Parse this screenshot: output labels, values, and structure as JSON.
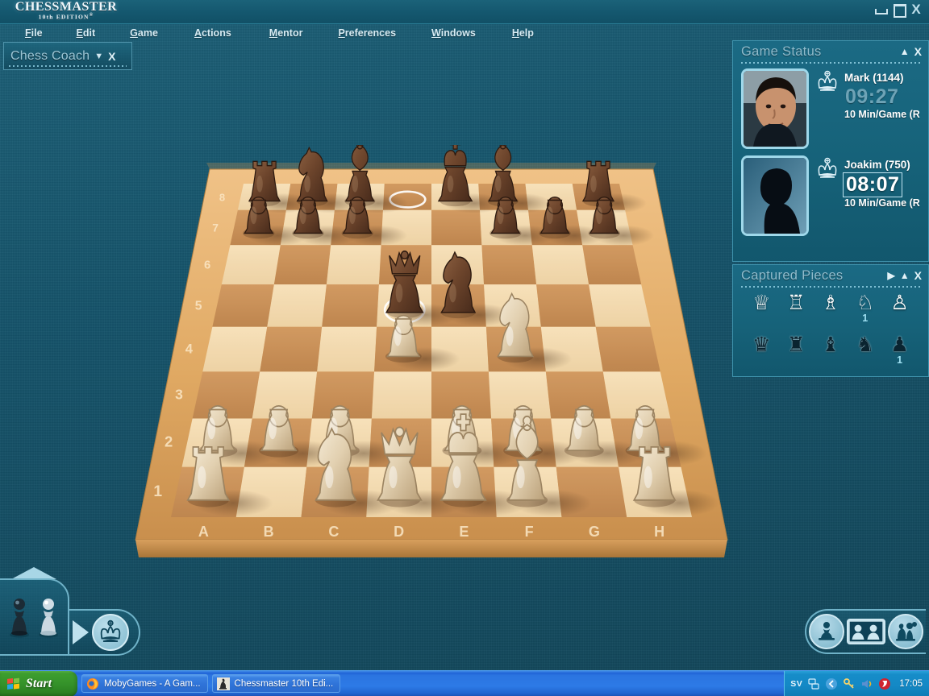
{
  "app": {
    "logo_line1": "CHESSMASTER",
    "logo_line2": "10th EDITION",
    "logo_registered": "®"
  },
  "window_controls": {
    "minimize": "minimize-icon",
    "maximize": "maximize-icon",
    "close": "X"
  },
  "menubar": {
    "items": [
      {
        "label": "File"
      },
      {
        "label": "Edit"
      },
      {
        "label": "Game"
      },
      {
        "label": "Actions"
      },
      {
        "label": "Mentor"
      },
      {
        "label": "Preferences"
      },
      {
        "label": "Windows"
      },
      {
        "label": "Help"
      }
    ]
  },
  "coach_panel": {
    "title": "Chess Coach",
    "collapse_caret": "▼",
    "close": "X"
  },
  "game_status": {
    "title": "Game Status",
    "collapse_caret": "▲",
    "close": "X",
    "players": [
      {
        "name": "Mark (1144)",
        "rating": "1144",
        "clock": "09:27",
        "time_control": "10 Min/Game (R",
        "side": "white",
        "active": false,
        "portrait": "photo-portrait"
      },
      {
        "name": "Joakim (750)",
        "rating": "750",
        "clock": "08:07",
        "time_control": "10 Min/Game (R",
        "side": "black",
        "active": true,
        "portrait": "silhouette-portrait"
      }
    ]
  },
  "captured_pieces": {
    "title": "Captured Pieces",
    "expand_caret": "▶",
    "collapse_caret": "▲",
    "close": "X",
    "rows": [
      {
        "color": "white",
        "cells": [
          {
            "piece": "queen",
            "glyph": "♕",
            "count": ""
          },
          {
            "piece": "rook",
            "glyph": "♖",
            "count": ""
          },
          {
            "piece": "bishop",
            "glyph": "♗",
            "count": ""
          },
          {
            "piece": "knight",
            "glyph": "♘",
            "count": "1"
          },
          {
            "piece": "pawn",
            "glyph": "♙",
            "count": ""
          }
        ]
      },
      {
        "color": "black",
        "cells": [
          {
            "piece": "queen",
            "glyph": "♛",
            "count": ""
          },
          {
            "piece": "rook",
            "glyph": "♜",
            "count": ""
          },
          {
            "piece": "bishop",
            "glyph": "♝",
            "count": ""
          },
          {
            "piece": "knight",
            "glyph": "♞",
            "count": ""
          },
          {
            "piece": "pawn",
            "glyph": "♟",
            "count": "1"
          }
        ]
      }
    ]
  },
  "board": {
    "files": [
      "A",
      "B",
      "C",
      "D",
      "E",
      "F",
      "G",
      "H"
    ],
    "ranks": [
      "8",
      "7",
      "6",
      "5",
      "4",
      "3",
      "2",
      "1"
    ],
    "highlights": [
      {
        "square": "D8",
        "type": "ring"
      },
      {
        "square": "D5",
        "type": "ring"
      }
    ],
    "pieces": [
      {
        "square": "A8",
        "color": "black",
        "type": "rook"
      },
      {
        "square": "B8",
        "color": "black",
        "type": "knight"
      },
      {
        "square": "C8",
        "color": "black",
        "type": "bishop"
      },
      {
        "square": "E8",
        "color": "black",
        "type": "king"
      },
      {
        "square": "F8",
        "color": "black",
        "type": "bishop"
      },
      {
        "square": "H8",
        "color": "black",
        "type": "rook"
      },
      {
        "square": "A7",
        "color": "black",
        "type": "pawn"
      },
      {
        "square": "B7",
        "color": "black",
        "type": "pawn"
      },
      {
        "square": "C7",
        "color": "black",
        "type": "pawn"
      },
      {
        "square": "F7",
        "color": "black",
        "type": "pawn"
      },
      {
        "square": "G7",
        "color": "black",
        "type": "pawn"
      },
      {
        "square": "H7",
        "color": "black",
        "type": "pawn"
      },
      {
        "square": "D5",
        "color": "black",
        "type": "queen"
      },
      {
        "square": "E5",
        "color": "black",
        "type": "knight"
      },
      {
        "square": "D4",
        "color": "white",
        "type": "pawn"
      },
      {
        "square": "F4",
        "color": "white",
        "type": "knight"
      },
      {
        "square": "A2",
        "color": "white",
        "type": "pawn"
      },
      {
        "square": "B2",
        "color": "white",
        "type": "pawn"
      },
      {
        "square": "C2",
        "color": "white",
        "type": "pawn"
      },
      {
        "square": "E2",
        "color": "white",
        "type": "pawn"
      },
      {
        "square": "F2",
        "color": "white",
        "type": "pawn"
      },
      {
        "square": "G2",
        "color": "white",
        "type": "pawn"
      },
      {
        "square": "H2",
        "color": "white",
        "type": "pawn"
      },
      {
        "square": "A1",
        "color": "white",
        "type": "rook"
      },
      {
        "square": "C1",
        "color": "white",
        "type": "knight"
      },
      {
        "square": "D1",
        "color": "white",
        "type": "queen"
      },
      {
        "square": "E1",
        "color": "white",
        "type": "king"
      },
      {
        "square": "F1",
        "color": "white",
        "type": "bishop"
      },
      {
        "square": "H1",
        "color": "white",
        "type": "rook"
      }
    ]
  },
  "coach_tray": {
    "expand_arrow": "▲",
    "play_arrow": "▶",
    "pawn_black_icon": "black-pawn-icon",
    "pawn_white_icon": "white-pawn-icon",
    "king_button_icon": "king-icon"
  },
  "bottom_buttons": {
    "items": [
      {
        "icon": "chess-piece-icon"
      },
      {
        "icon": "players-faces-icon"
      },
      {
        "icon": "pieces-set-icon"
      }
    ]
  },
  "taskbar": {
    "start_label": "Start",
    "tasks": [
      {
        "label": "MobyGames - A Gam...",
        "icon": "firefox-icon"
      },
      {
        "label": "Chessmaster 10th Edi...",
        "icon": "chessmaster-icon"
      }
    ],
    "tray": {
      "language": "SV",
      "icons": [
        "network-icon",
        "shield-blue-icon",
        "keys-icon",
        "speaker-icon",
        "antivirus-icon"
      ],
      "clock": "17:05"
    }
  },
  "colors": {
    "desk": "#155a70",
    "panel_bg": "#166279",
    "panel_border": "#3f93ad",
    "title_text": "#8fbccd",
    "accent_text": "#ffffff",
    "board_light": "#f2d7ab",
    "board_dark": "#c2884e",
    "board_frame": "#e2ab67",
    "taskbar_blue": "#2d7ae6",
    "start_green": "#35922a",
    "count_text": "#9fe0f2"
  }
}
